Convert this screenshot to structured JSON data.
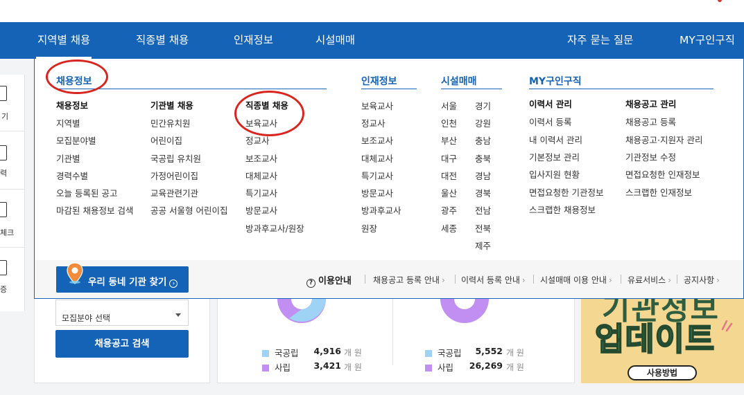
{
  "nav": {
    "items": [
      "지역별 채용",
      "직종별 채용",
      "인재정보",
      "시설매매"
    ],
    "right": [
      "자주 묻는 질문",
      "MY구인구직"
    ]
  },
  "side": {
    "labels": [
      "기",
      "력",
      "체크",
      "증"
    ]
  },
  "menu": {
    "job": {
      "title": "채용정보",
      "col1": {
        "head": "채용정보",
        "items": [
          "지역별",
          "모집분야별",
          "기관별",
          "경력수별",
          "오늘 등록된 공고",
          "마감된 채용정보 검색"
        ]
      },
      "col2": {
        "head": "기관별 채용",
        "items": [
          "민간유치원",
          "어린이집",
          "국공립 유치원",
          "가정어린이집",
          "교육관련기관",
          "공공 서울형 어린이집"
        ]
      },
      "col3": {
        "head": "직종별 채용",
        "items": [
          "보육교사",
          "정교사",
          "보조교사",
          "대체교사",
          "특기교사",
          "방문교사",
          "방과후교사/원장"
        ]
      }
    },
    "talent": {
      "title": "인재정보",
      "items": [
        "보육교사",
        "정교사",
        "보조교사",
        "대체교사",
        "특기교사",
        "방문교사",
        "방과후교사",
        "원장"
      ]
    },
    "facility": {
      "title": "시설매매",
      "left": [
        "서울",
        "인천",
        "부산",
        "대구",
        "대전",
        "울산",
        "광주",
        "세종"
      ],
      "right": [
        "경기",
        "강원",
        "충남",
        "충북",
        "경남",
        "경북",
        "전남",
        "전북",
        "제주"
      ]
    },
    "my": {
      "title": "MY구인구직",
      "col1": {
        "head": "이력서 관리",
        "items": [
          "이력서 등록",
          "내 이력서 관리",
          "기본정보 관리",
          "입사지원 현황",
          "면접요청한 기관정보",
          "스크랩한 채용정보"
        ]
      },
      "col2": {
        "head": "채용공고 관리",
        "items": [
          "채용공고 등록",
          "채용공고·지원자 관리",
          "기관정보 수정",
          "면접요청한 인재정보",
          "스크랩한 인재정보"
        ]
      }
    },
    "footer": {
      "find_button": "우리 동네 기관 찾기",
      "guide_title": "이용안내",
      "guide_links": [
        "채용공고 등록 안내",
        "이력서 등록 안내",
        "시설매매 이용 안내",
        "유료서비스",
        "공지사항"
      ]
    }
  },
  "below": {
    "select_label": "모집분야 선택",
    "search_button": "채용공고 검색",
    "stats": [
      {
        "public_label": "국공립",
        "public_value": "4,916",
        "private_label": "사립",
        "private_value": "3,421",
        "unit": "개 원"
      },
      {
        "public_label": "국공립",
        "public_value": "5,552",
        "private_label": "사립",
        "private_value": "26,269",
        "unit": "개 원"
      }
    ],
    "banner": {
      "line1": "기관정보",
      "line2": "업데이트",
      "button": "사용방법"
    }
  },
  "colors": {
    "brand": "#1463b6",
    "public": "#9ed3f5",
    "private": "#c18ef2",
    "highlight": "#d8261f"
  }
}
